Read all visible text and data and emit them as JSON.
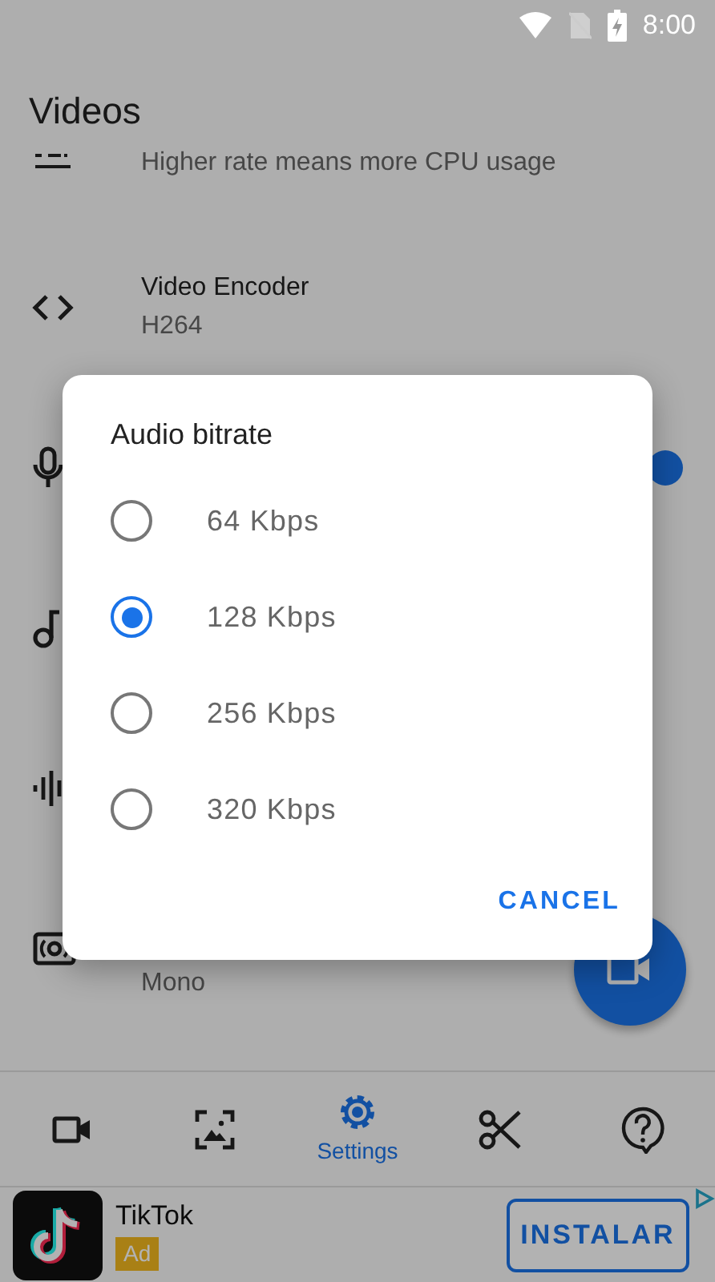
{
  "status_bar": {
    "time": "8:00"
  },
  "header": {
    "title": "Videos"
  },
  "settings": [
    {
      "kind": "list",
      "subtitle": "Higher rate means more CPU usage"
    },
    {
      "kind": "code",
      "title": "Video Encoder",
      "subtitle": "H264"
    },
    {
      "kind": "mic",
      "toggle": {
        "on": true
      }
    },
    {
      "kind": "note"
    },
    {
      "kind": "wave"
    },
    {
      "kind": "surround",
      "subtitle": "Mono"
    }
  ],
  "dialog": {
    "title": "Audio bitrate",
    "options": [
      {
        "label": "64 Kbps",
        "selected": false
      },
      {
        "label": "128 Kbps",
        "selected": true
      },
      {
        "label": "256 Kbps",
        "selected": false
      },
      {
        "label": "320 Kbps",
        "selected": false
      }
    ],
    "cancel": "CANCEL"
  },
  "bottom_nav": [
    {
      "selected": false
    },
    {
      "selected": false
    },
    {
      "label": "Settings",
      "selected": true
    },
    {
      "selected": false
    },
    {
      "selected": false
    }
  ],
  "ad": {
    "app_name": "TikTok",
    "badge": "Ad",
    "button": "INSTALAR"
  }
}
